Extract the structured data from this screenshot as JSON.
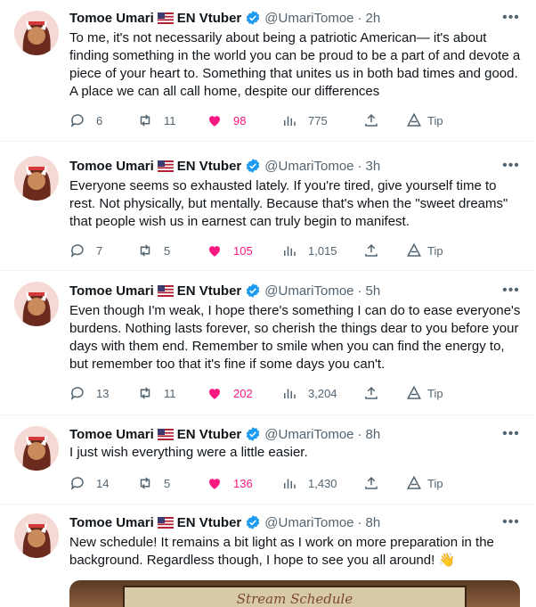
{
  "tweets": [
    {
      "name": "Tomoe Umari",
      "flag": "🇺🇸",
      "suffix": "EN Vtuber",
      "handle": "@UmariTomoe",
      "time": "2h",
      "text": "To me, it's not necessarily about being a patriotic American— it's about finding something in the world you can be proud to be a part of and devote a piece of your heart to. Something that unites us in both bad times and good. A place we can all call home, despite our differences",
      "replies": "6",
      "retweets": "11",
      "likes": "98",
      "views": "775",
      "tip": "Tip"
    },
    {
      "name": "Tomoe Umari",
      "flag": "🇺🇸",
      "suffix": "EN Vtuber",
      "handle": "@UmariTomoe",
      "time": "3h",
      "text": "Everyone seems so exhausted lately. If you're tired, give yourself time to rest. Not physically, but mentally. Because that's when the \"sweet dreams\" that people wish us in earnest can truly begin to manifest.",
      "replies": "7",
      "retweets": "5",
      "likes": "105",
      "views": "1,015",
      "tip": "Tip"
    },
    {
      "name": "Tomoe Umari",
      "flag": "🇺🇸",
      "suffix": "EN Vtuber",
      "handle": "@UmariTomoe",
      "time": "5h",
      "text": "Even though I'm weak, I hope there's something I can do to ease everyone's burdens. Nothing lasts forever, so cherish the things dear to you before your days with them end. Remember to smile when you can find the energy to, but remember too that it's fine if some days you can't.",
      "replies": "13",
      "retweets": "11",
      "likes": "202",
      "views": "3,204",
      "tip": "Tip"
    },
    {
      "name": "Tomoe Umari",
      "flag": "🇺🇸",
      "suffix": "EN Vtuber",
      "handle": "@UmariTomoe",
      "time": "8h",
      "text": "I just wish everything were a little easier.",
      "replies": "14",
      "retweets": "5",
      "likes": "136",
      "views": "1,430",
      "tip": "Tip"
    },
    {
      "name": "Tomoe Umari",
      "flag": "🇺🇸",
      "suffix": "EN Vtuber",
      "handle": "@UmariTomoe",
      "time": "8h",
      "text": "New schedule! It remains a bit light as I work on more preparation in the background. Regardless though, I hope to see you all around! 👋",
      "media_title": "Stream Schedule"
    }
  ],
  "colors": {
    "accent": "#1d9bf0",
    "like": "#f91880",
    "muted": "#536471",
    "text": "#0f1419"
  },
  "icons": [
    "reply-icon",
    "retweet-icon",
    "heart-icon",
    "views-icon",
    "share-icon",
    "tip-icon",
    "verified-icon",
    "more-icon"
  ]
}
